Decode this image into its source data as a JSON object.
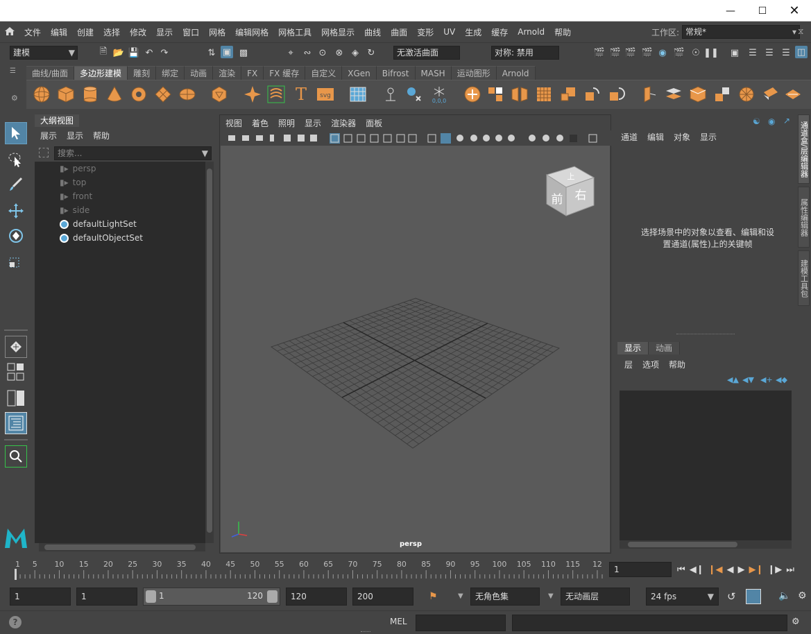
{
  "menubar": {
    "items": [
      "文件",
      "编辑",
      "创建",
      "选择",
      "修改",
      "显示",
      "窗口",
      "网格",
      "编辑网格",
      "网格工具",
      "网格显示",
      "曲线",
      "曲面",
      "变形",
      "UV",
      "生成",
      "缓存",
      "Arnold",
      "帮助"
    ],
    "workspace_label": "工作区:",
    "workspace_value": "常规*"
  },
  "statusline": {
    "mode": "建模",
    "live_surface": "无激活曲面",
    "symmetry": "对称: 禁用"
  },
  "shelf": {
    "tabs": [
      "曲线/曲面",
      "多边形建模",
      "雕刻",
      "绑定",
      "动画",
      "渲染",
      "FX",
      "FX 缓存",
      "自定义",
      "XGen",
      "Bifrost",
      "MASH",
      "运动图形",
      "Arnold"
    ],
    "active_tab": 1
  },
  "outliner": {
    "tab_title": "大纲视图",
    "menu": [
      "展示",
      "显示",
      "帮助"
    ],
    "search_placeholder": "搜索...",
    "items": [
      {
        "label": "persp",
        "icon": "camera-icon",
        "dim": true
      },
      {
        "label": "top",
        "icon": "camera-icon",
        "dim": true
      },
      {
        "label": "front",
        "icon": "camera-icon",
        "dim": true
      },
      {
        "label": "side",
        "icon": "camera-icon",
        "dim": true
      },
      {
        "label": "defaultLightSet",
        "icon": "set-icon",
        "dim": false
      },
      {
        "label": "defaultObjectSet",
        "icon": "set-icon",
        "dim": false
      }
    ]
  },
  "viewport": {
    "menu": [
      "视图",
      "着色",
      "照明",
      "显示",
      "渲染器",
      "面板"
    ],
    "camera_label": "persp",
    "viewcube": {
      "top": "上",
      "front": "前",
      "right": "右"
    }
  },
  "channel_box": {
    "menu": [
      "通道",
      "编辑",
      "对象",
      "显示"
    ],
    "message_line1": "选择场景中的对象以查看、编辑和设",
    "message_line2": "置通道(属性)上的关键帧"
  },
  "layer_editor": {
    "tabs": [
      "显示",
      "动画"
    ],
    "menu": [
      "层",
      "选项",
      "帮助"
    ]
  },
  "side_tabs": [
    "通道盒/层编辑器",
    "属性编辑器",
    "建模工具包"
  ],
  "timeslider": {
    "ticks": [
      "1",
      "5",
      "10",
      "15",
      "20",
      "25",
      "30",
      "35",
      "40",
      "45",
      "50",
      "55",
      "60",
      "65",
      "70",
      "75",
      "80",
      "85",
      "90",
      "95",
      "100",
      "105",
      "110",
      "115",
      "12"
    ],
    "current_frame": "1"
  },
  "rangebar": {
    "start": "1",
    "playback_start": "1",
    "range_min": "1",
    "range_max": "120",
    "playback_end": "120",
    "end": "200",
    "character_set": "无角色集",
    "anim_layer": "无动画层",
    "fps": "24 fps"
  },
  "cmdline": {
    "language": "MEL"
  },
  "colors": {
    "accent_orange": "#e8974a",
    "highlight_blue": "#5285a6",
    "panel_bg": "#444444",
    "field_bg": "#2b2b2b"
  }
}
